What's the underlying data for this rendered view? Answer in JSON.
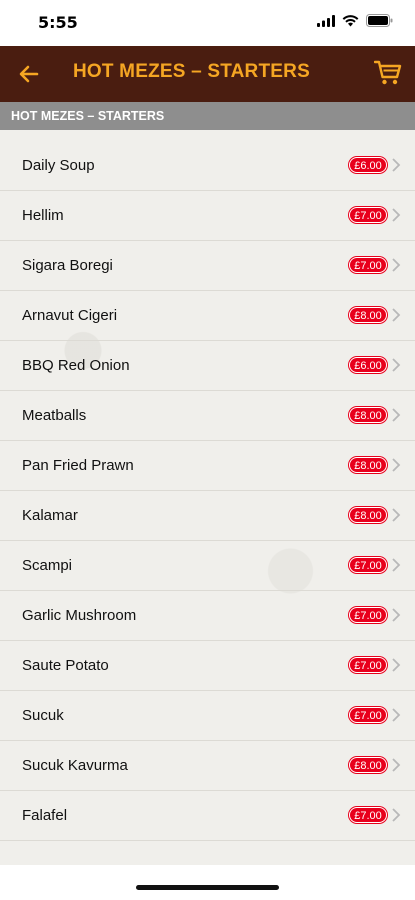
{
  "status": {
    "time": "5:55"
  },
  "nav": {
    "title": "HOT MEZES – STARTERS"
  },
  "section": {
    "title": "HOT MEZES – STARTERS"
  },
  "items": [
    {
      "name": "Daily Soup",
      "price": "£6.00"
    },
    {
      "name": "Hellim",
      "price": "£7.00"
    },
    {
      "name": "Sigara Boregi",
      "price": "£7.00"
    },
    {
      "name": "Arnavut Cigeri",
      "price": "£8.00"
    },
    {
      "name": "BBQ Red Onion",
      "price": "£6.00"
    },
    {
      "name": "Meatballs",
      "price": "£8.00"
    },
    {
      "name": "Pan Fried Prawn",
      "price": "£8.00"
    },
    {
      "name": "Kalamar",
      "price": "£8.00"
    },
    {
      "name": "Scampi",
      "price": "£7.00"
    },
    {
      "name": "Garlic Mushroom",
      "price": "£7.00"
    },
    {
      "name": "Saute Potato",
      "price": "£7.00"
    },
    {
      "name": "Sucuk",
      "price": "£7.00"
    },
    {
      "name": "Sucuk Kavurma",
      "price": "£8.00"
    },
    {
      "name": "Falafel",
      "price": "£7.00"
    }
  ],
  "colors": {
    "nav_background": "#4a1d10",
    "nav_text": "#f5a623",
    "price_badge": "#e8001c",
    "section_header": "#8e8e8e"
  },
  "icons": {
    "back": "arrow-left-icon",
    "cart": "cart-icon",
    "chevron": "chevron-right-icon"
  }
}
